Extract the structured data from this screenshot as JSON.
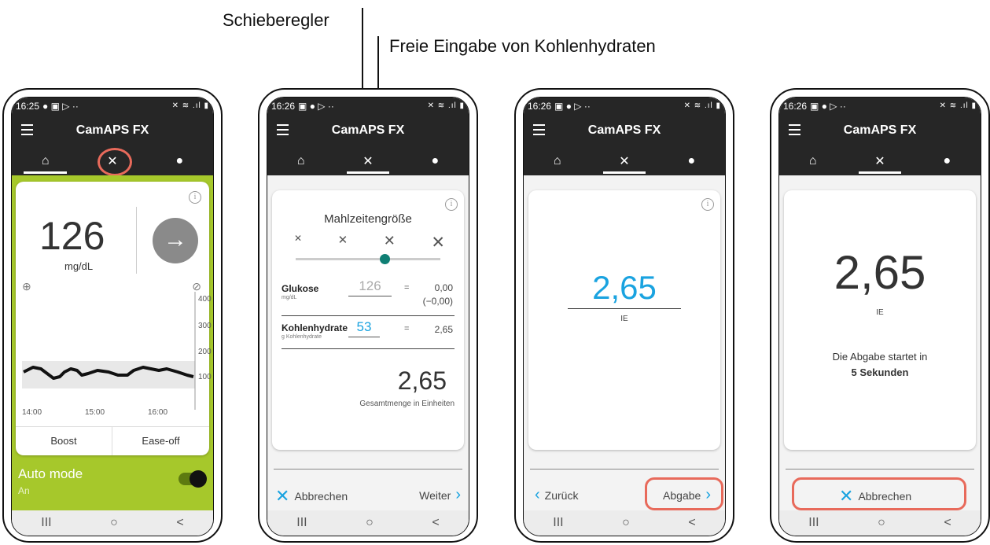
{
  "annotations": {
    "slider_label": "Schieberegler",
    "carb_input_label": "Freie Eingabe von Kohlenhydraten"
  },
  "app": {
    "title": "CamAPS FX"
  },
  "system_nav": {
    "recent": "III",
    "home": "○",
    "back": "<"
  },
  "screen1": {
    "time": "16:25",
    "glucose_value": "126",
    "glucose_unit": "mg/dL",
    "y_ticks": [
      "400",
      "300",
      "200",
      "100"
    ],
    "x_ticks": [
      "14:00",
      "15:00",
      "16:00"
    ],
    "boost_label": "Boost",
    "easeoff_label": "Ease-off",
    "auto_mode_label": "Auto mode",
    "auto_mode_state": "An",
    "accent_color": "#a6c82b"
  },
  "screen2": {
    "time": "16:26",
    "title": "Mahlzeitengröße",
    "slider_value_fraction": 0.58,
    "glucose_label": "Glukose",
    "glucose_unit": "mg/dL",
    "glucose_value": "126",
    "glucose_eq": "=",
    "glucose_result": "0,00",
    "glucose_result_sub": "(−0,00)",
    "carbs_label": "Kohlenhydrate",
    "carbs_unit": "g Kohlenhydrate",
    "carbs_value": "53",
    "carbs_eq": "=",
    "carbs_result": "2,65",
    "total_value": "2,65",
    "total_label": "Gesamtmenge in Einheiten",
    "cancel_label": "Abbrechen",
    "next_label": "Weiter"
  },
  "screen3": {
    "time": "16:26",
    "dose_value": "2,65",
    "dose_unit": "IE",
    "back_label": "Zurück",
    "deliver_label": "Abgabe"
  },
  "screen4": {
    "time": "16:26",
    "dose_value": "2,65",
    "dose_unit": "IE",
    "message_line1": "Die Abgabe startet in",
    "message_line2": "5 Sekunden",
    "cancel_label": "Abbrechen"
  },
  "colors": {
    "highlight": "#e86a5b",
    "blue": "#1aa3e0",
    "teal": "#0f7f74",
    "dark": "#262626"
  }
}
